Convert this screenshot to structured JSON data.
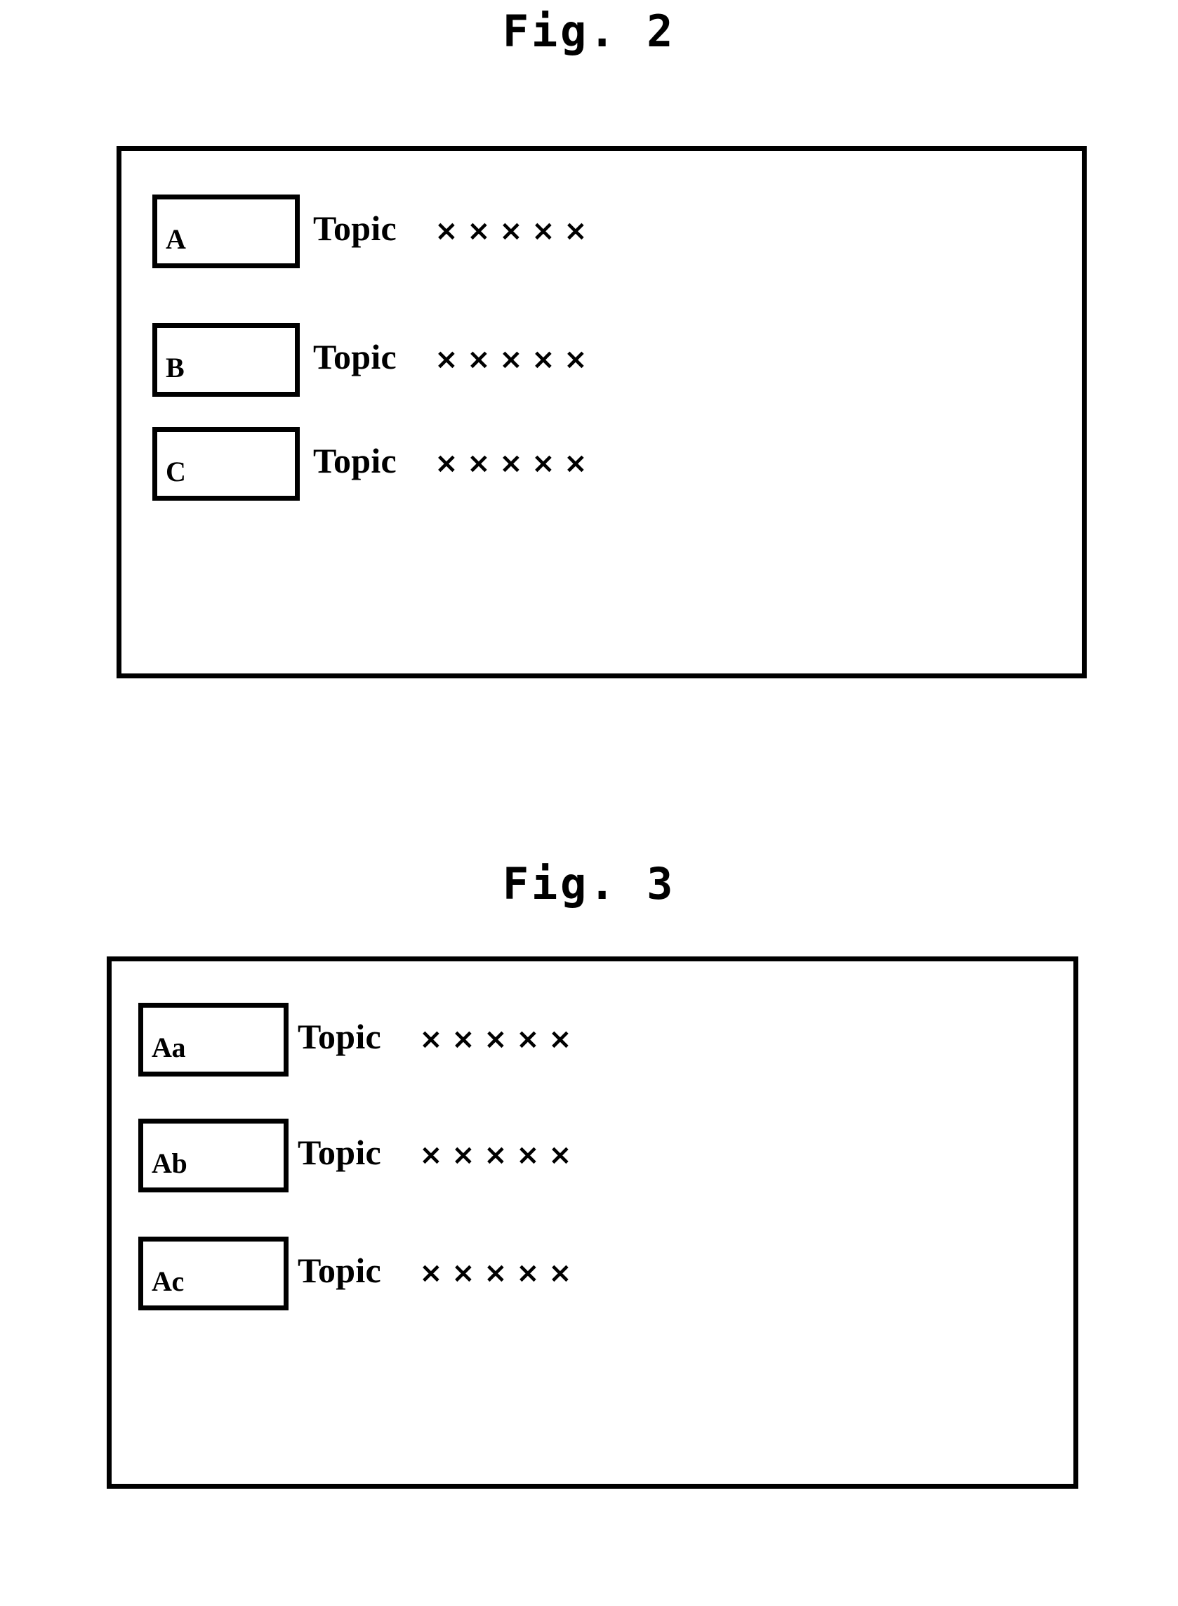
{
  "figures": [
    {
      "caption": "Fig. 2",
      "rows": [
        {
          "label": "A",
          "topic": "Topic",
          "marks": [
            "×",
            "×",
            "×",
            "×",
            "×"
          ]
        },
        {
          "label": "B",
          "topic": "Topic",
          "marks": [
            "×",
            "×",
            "×",
            "×",
            "×"
          ]
        },
        {
          "label": "C",
          "topic": "Topic",
          "marks": [
            "×",
            "×",
            "×",
            "×",
            "×"
          ]
        }
      ]
    },
    {
      "caption": "Fig. 3",
      "rows": [
        {
          "label": "Aa",
          "topic": "Topic",
          "marks": [
            "×",
            "×",
            "×",
            "×",
            "×"
          ]
        },
        {
          "label": "Ab",
          "topic": "Topic",
          "marks": [
            "×",
            "×",
            "×",
            "×",
            "×"
          ]
        },
        {
          "label": "Ac",
          "topic": "Topic",
          "marks": [
            "×",
            "×",
            "×",
            "×",
            "×"
          ]
        }
      ]
    }
  ],
  "colors": {
    "ink": "#000000",
    "paper": "#ffffff"
  }
}
